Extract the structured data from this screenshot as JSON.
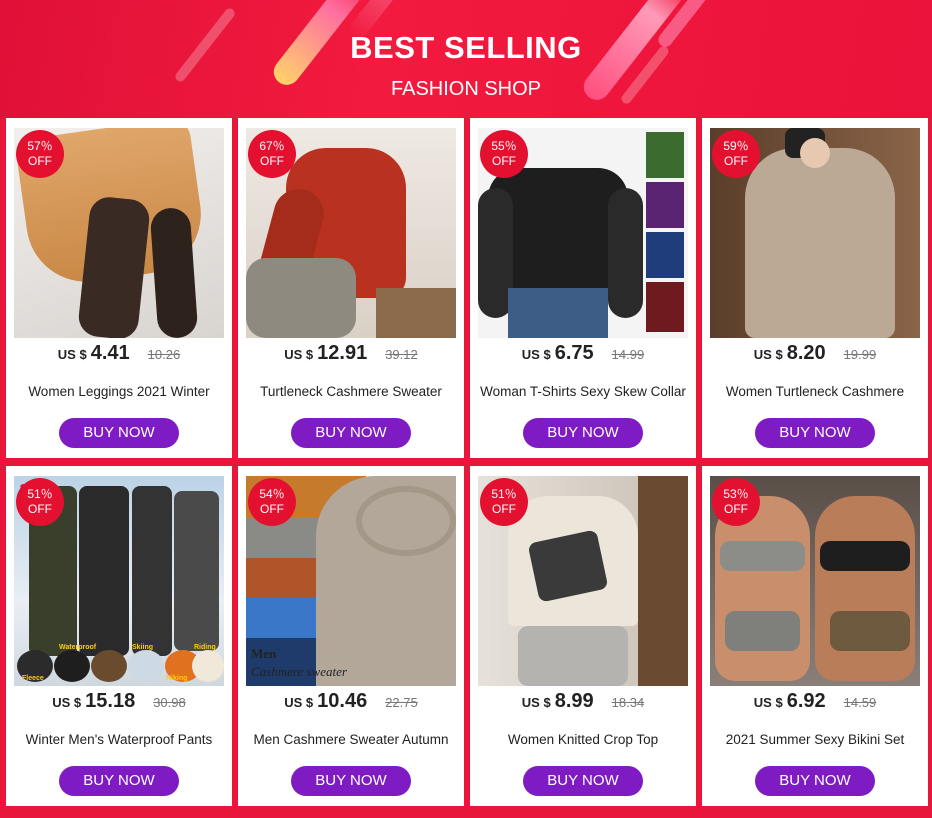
{
  "banner": {
    "title": "BEST SELLING",
    "subtitle": "FASHION SHOP"
  },
  "colors": {
    "background": "#e8163a",
    "button": "#7e1bc2",
    "badge": "#e3102f"
  },
  "products": [
    {
      "badge_pct": "57％",
      "badge_off": "OFF",
      "currency": "US $",
      "price": "4.41",
      "old_price": "10.26",
      "name": "Women Leggings 2021 Winter",
      "button": "BUY NOW"
    },
    {
      "badge_pct": "67％",
      "badge_off": "OFF",
      "currency": "US $",
      "price": "12.91",
      "old_price": "39.12",
      "name": "Turtleneck Cashmere Sweater",
      "button": "BUY NOW"
    },
    {
      "badge_pct": "55％",
      "badge_off": "OFF",
      "currency": "US $",
      "price": "6.75",
      "old_price": "14.99",
      "name": "Woman T-Shirts Sexy Skew Collar",
      "button": "BUY NOW"
    },
    {
      "badge_pct": "59％",
      "badge_off": "OFF",
      "currency": "US $",
      "price": "8.20",
      "old_price": "19.99",
      "name": "Women Turtleneck Cashmere",
      "button": "BUY NOW"
    },
    {
      "badge_pct": "51％",
      "badge_off": "OFF",
      "currency": "US $",
      "price": "15.18",
      "old_price": "30.98",
      "name": "Winter Men's Waterproof Pants",
      "button": "BUY NOW",
      "image_text": [
        "S-5XL",
        "Waterproof",
        "Skiing",
        "Riding",
        "Fleece",
        "Hiking"
      ]
    },
    {
      "badge_pct": "54％",
      "badge_off": "OFF",
      "currency": "US $",
      "price": "10.46",
      "old_price": "22.75",
      "name": "Men Cashmere Sweater Autumn",
      "button": "BUY NOW",
      "image_text": [
        "Men",
        "Cashmere sweater"
      ]
    },
    {
      "badge_pct": "51％",
      "badge_off": "OFF",
      "currency": "US $",
      "price": "8.99",
      "old_price": "18.34",
      "name": "Women Knitted Crop Top",
      "button": "BUY NOW"
    },
    {
      "badge_pct": "53％",
      "badge_off": "OFF",
      "currency": "US $",
      "price": "6.92",
      "old_price": "14.59",
      "name": "2021 Summer Sexy Bikini Set",
      "button": "BUY NOW"
    }
  ]
}
